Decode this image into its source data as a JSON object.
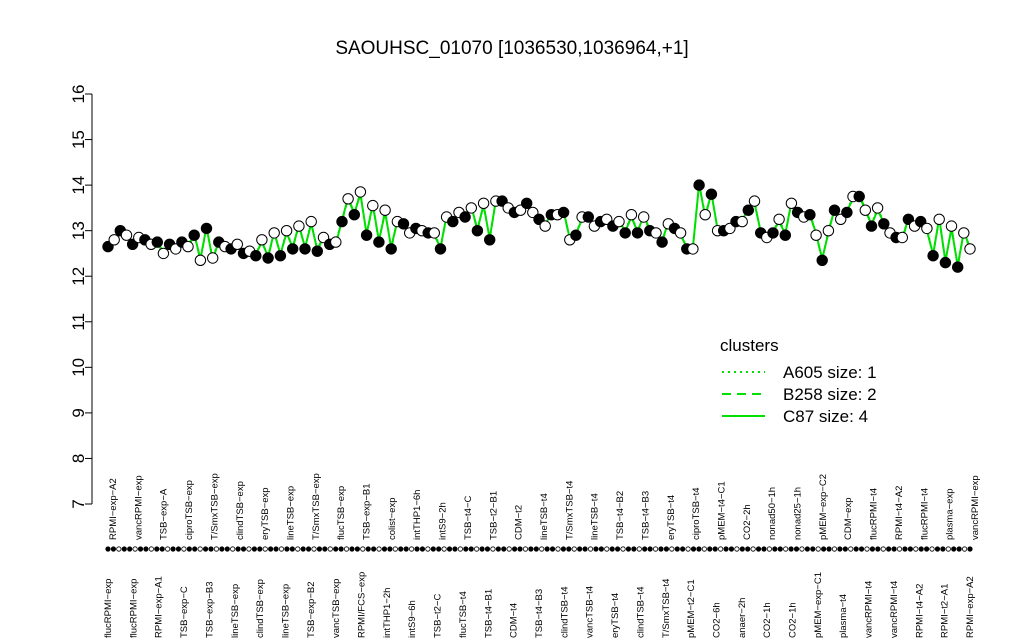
{
  "chart_data": {
    "type": "line",
    "title": "SAOUHSC_01070 [1036530,1036964,+1]",
    "xlabel": "",
    "ylabel": "",
    "ylim": [
      7,
      16
    ],
    "yticks": [
      7,
      8,
      9,
      10,
      11,
      12,
      13,
      14,
      15,
      16
    ],
    "top_labels": [
      "RPMI−exp−A2",
      "vancRPMI−exp",
      "TSB−exp−A",
      "ciproTSB−exp",
      "T/SmxTSB−exp",
      "clindTSB−exp",
      "eryTSB−exp",
      "lineTSB−exp",
      "T/SmxTSB−exp",
      "flucTSB−exp",
      "TSB−exp−B1",
      "colist−exp",
      "intTHP1−6h",
      "intS9−2h",
      "TSB−t4−C",
      "TSB−t2−B1",
      "CDM−t2",
      "lineTSB−t4",
      "T/SmxTSB−t4",
      "lineTSB−t4",
      "TSB−t4−B2",
      "TSB−t4−B3",
      "eryTSB−t4",
      "ciproTSB−t4",
      "pMEM−t4−C1",
      "CO2−2h",
      "nonad50−1h",
      "nonad25−1h",
      "pMEM−exp−C2",
      "CDM−exp",
      "flucRPMI−t4",
      "RPMI−t4−A2",
      "flucRPMI−t4",
      "plasma−exp",
      "vancRPMI−exp"
    ],
    "bottom_labels": [
      "flucRPMI−exp",
      "flucRPMI−exp",
      "RPMI−exp−A1",
      "TSB−exp−C",
      "TSB−exp−B3",
      "lineTSB−exp",
      "clindTSB−exp",
      "lineTSB−exp",
      "TSB−exp−B2",
      "vancTSB−exp",
      "RPMI/FCS−exp",
      "intTHP1−2h",
      "intS9−6h",
      "TSB−t2−C",
      "flucTSB−t4",
      "TSB−t4−B1",
      "CDM−t4",
      "TSB−t4−B3",
      "clindTSB−t4",
      "vancTSB−t4",
      "eryTSB−t4",
      "clindTSB−t4",
      "T/SmxTSB−t4",
      "pMEM−t2−C1",
      "CO2−6h",
      "anaer−2h",
      "CO2−1h",
      "CO2−1h",
      "pMEM−exp−C1",
      "plasma−t4",
      "vancRPMI−t4",
      "vancRPMI−t4",
      "RPMI−t4−A2",
      "RPMI−t2−A1",
      "RPMI−exp−A2"
    ],
    "x": [
      1,
      2,
      3,
      4,
      5,
      6,
      7,
      8,
      9,
      10,
      11,
      12,
      13,
      14,
      15,
      16,
      17,
      18,
      19,
      20,
      21,
      22,
      23,
      24,
      25,
      26,
      27,
      28,
      29,
      30,
      31,
      32,
      33,
      34,
      35,
      36,
      37,
      38,
      39,
      40,
      41,
      42,
      43,
      44,
      45,
      46,
      47,
      48,
      49,
      50,
      51,
      52,
      53,
      54,
      55,
      56,
      57,
      58,
      59,
      60,
      61,
      62,
      63,
      64,
      65,
      66,
      67,
      68,
      69,
      70,
      71,
      72,
      73,
      74,
      75,
      76,
      77,
      78,
      79,
      80,
      81,
      82,
      83,
      84,
      85,
      86,
      87,
      88,
      89,
      90,
      91,
      92,
      93,
      94,
      95,
      96,
      97,
      98,
      99,
      100,
      101,
      102,
      103,
      104,
      105,
      106,
      107,
      108,
      109,
      110,
      111,
      112,
      113,
      114,
      115,
      116,
      117,
      118,
      119,
      120,
      121,
      122,
      123,
      124,
      125,
      126,
      127,
      128,
      129,
      130,
      131,
      132,
      133,
      134,
      135,
      136,
      137,
      138,
      139,
      140,
      141,
      142,
      143,
      144,
      145,
      146,
      147,
      148,
      149,
      150,
      151,
      152,
      153,
      154,
      155,
      156,
      157,
      158,
      159,
      160
    ],
    "points": {
      "filled": [
        12.65,
        13.0,
        12.7,
        12.8,
        12.75,
        12.7,
        12.75,
        12.9,
        13.05,
        12.75,
        12.6,
        12.5,
        12.45,
        12.4,
        12.45,
        12.6,
        12.6,
        12.55,
        12.7,
        13.2,
        13.35,
        12.9,
        12.75,
        12.6,
        13.15,
        13.05,
        12.95,
        12.6,
        13.2,
        13.3,
        13.0,
        12.8,
        13.65,
        13.4,
        13.6,
        13.25,
        13.35,
        13.4,
        12.9,
        13.3,
        13.2,
        13.1,
        12.95,
        12.95,
        13.0,
        12.75,
        13.05,
        12.6,
        14.0,
        13.8,
        13.0,
        13.2,
        13.45,
        12.95,
        12.95,
        12.9,
        13.4,
        13.35,
        12.35,
        13.45,
        13.4,
        13.75,
        13.1,
        13.15,
        12.85,
        13.25,
        13.2,
        12.45,
        12.3,
        12.2
      ],
      "open": [
        12.8,
        12.9,
        12.85,
        12.7,
        12.5,
        12.6,
        12.65,
        12.35,
        12.4,
        12.65,
        12.7,
        12.55,
        12.8,
        12.95,
        13.0,
        13.1,
        13.2,
        12.85,
        12.75,
        13.7,
        13.85,
        13.55,
        13.45,
        13.2,
        12.95,
        13.0,
        12.95,
        13.3,
        13.4,
        13.5,
        13.6,
        13.65,
        13.5,
        13.45,
        13.4,
        13.1,
        13.35,
        12.8,
        13.3,
        13.1,
        13.25,
        13.2,
        13.35,
        13.3,
        12.95,
        13.15,
        12.95,
        12.6,
        13.35,
        13.0,
        13.05,
        13.2,
        13.65,
        12.85,
        13.25,
        13.6,
        13.3,
        12.9,
        13.0,
        13.25,
        13.75,
        13.45,
        13.5,
        12.95,
        12.85,
        13.1,
        13.05,
        13.25,
        13.1,
        12.95,
        12.6
      ]
    },
    "series": [
      {
        "name": "A605 size: 1",
        "style": "dotted",
        "color": "#00e000"
      },
      {
        "name": "B258 size: 2",
        "style": "dashed",
        "color": "#00e000"
      },
      {
        "name": "C87 size: 4",
        "style": "solid",
        "color": "#00e000"
      }
    ],
    "legend": {
      "title": "clusters",
      "placement": "right"
    },
    "colors": {
      "line": "#00e000",
      "axis": "#000000",
      "point_fill": "#000000"
    }
  }
}
